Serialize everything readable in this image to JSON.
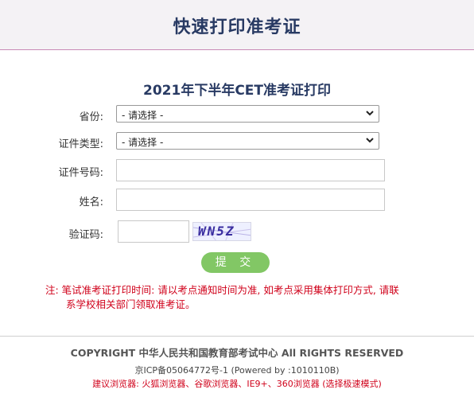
{
  "header": {
    "title": "快速打印准考证"
  },
  "form": {
    "title": "2021年下半年CET准考证打印",
    "province": {
      "label": "省份:",
      "selected": "- 请选择 -"
    },
    "id_type": {
      "label": "证件类型:",
      "selected": "- 请选择 -"
    },
    "id_number": {
      "label": "证件号码:",
      "value": ""
    },
    "name": {
      "label": "姓名:",
      "value": ""
    },
    "captcha": {
      "label": "验证码:",
      "value": "",
      "image_text": "WN5Z"
    },
    "submit_label": "提 交"
  },
  "note": {
    "line1": "注: 笔试准考证打印时间: 请以考点通知时间为准, 如考点采用集体打印方式, 请联",
    "line2": "系学校相关部门领取准考证。"
  },
  "footer": {
    "copyright": "COPYRIGHT 中华人民共和国教育部考试中心 All RIGHTS RESERVED",
    "icp": "京ICP备05064772号-1 (Powered by :1010110B)",
    "browser_hint": "建议浏览器: 火狐浏览器、谷歌浏览器、IE9+、360浏览器 (选择极速模式)"
  },
  "colors": {
    "title": "#283a63",
    "accent_line": "#c88ab6",
    "submit": "#82c765",
    "warning": "#d0021b"
  }
}
